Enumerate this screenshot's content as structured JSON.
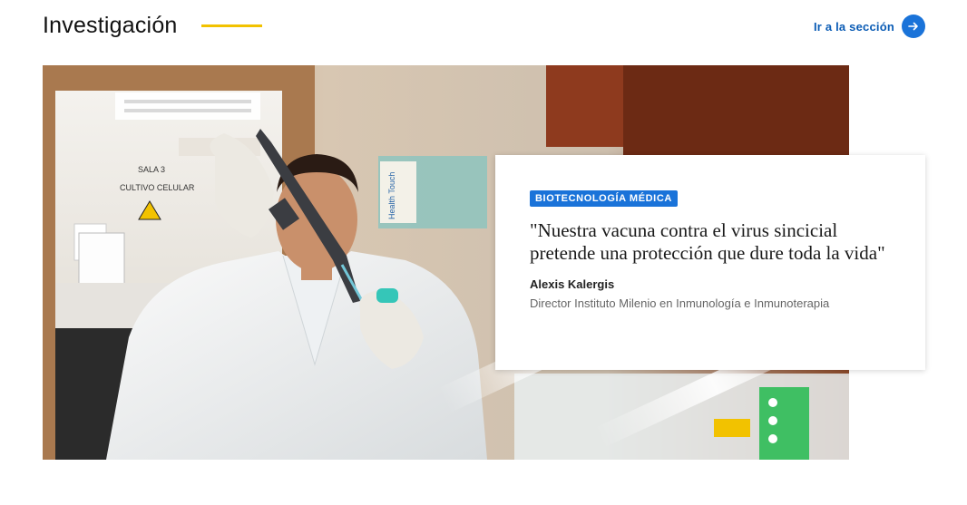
{
  "section": {
    "title": "Investigación",
    "link_label": "Ir a la sección",
    "accent_color": "#f2c200",
    "link_color": "#1a73d9"
  },
  "feature": {
    "image_icon": "scientist-lab-photo",
    "photo_text": {
      "sign_line1": "SALA 3",
      "sign_line2": "CULTIVO CELULAR",
      "box_label": "Health Touch"
    },
    "badge": "BIOTECNOLOGÍA MÉDICA",
    "quote": "\"Nuestra vacuna contra el virus sincicial pretende una protección que dure toda la vida\"",
    "author": "Alexis Kalergis",
    "role": "Director Instituto Milenio en Inmunología e Inmunoterapia"
  }
}
